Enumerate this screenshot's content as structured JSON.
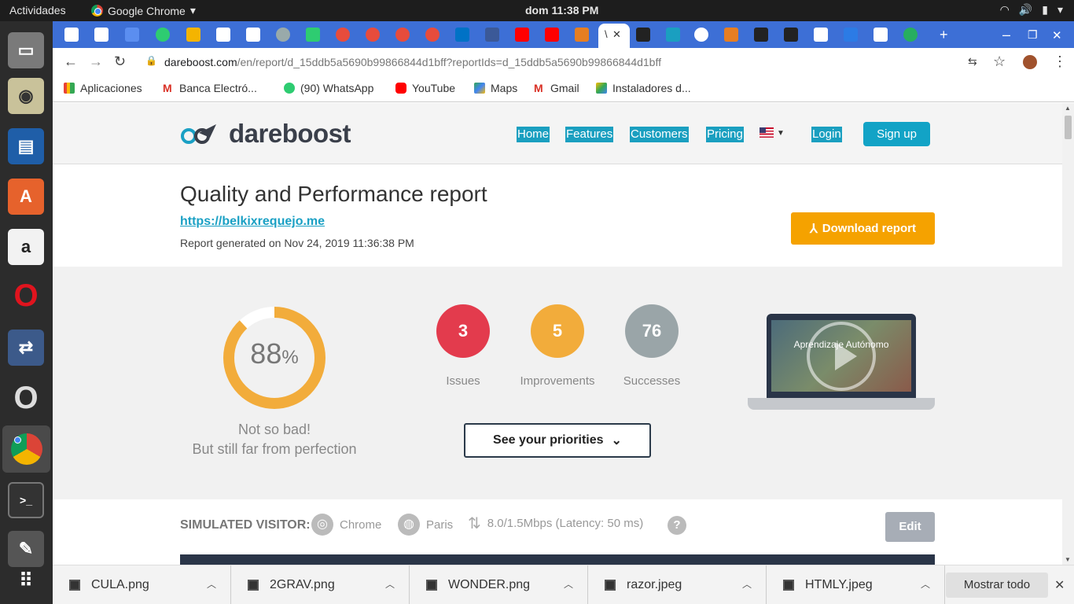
{
  "system": {
    "activities": "Actividades",
    "app_name": "Google Chrome",
    "clock": "dom 11:38 PM"
  },
  "browser": {
    "url_host": "dareboost.com",
    "url_path": "/en/report/d_15ddb5a5690b99866844d1bff?reportIds=d_15ddb5a5690b99866844d1bff",
    "active_tab_title": "\\",
    "bookmarks": [
      "Aplicaciones",
      "Banca Electró...",
      "(90) WhatsApp",
      "YouTube",
      "Maps",
      "Gmail",
      "Instaladores d..."
    ]
  },
  "site": {
    "logo_text": "dareboost",
    "nav": [
      "Home",
      "Features",
      "Customers",
      "Pricing"
    ],
    "login": "Login",
    "signup": "Sign up"
  },
  "report": {
    "title": "Quality and Performance report",
    "url": "https://belkixrequejo.me",
    "generated": "Report generated on Nov 24, 2019 11:36:38 PM",
    "download": "Download report"
  },
  "summary": {
    "score": "88",
    "score_unit": "%",
    "score_fraction": 0.88,
    "verdict_line1": "Not so bad!",
    "verdict_line2": "But still far from perfection",
    "issues_count": "3",
    "issues_label": "Issues",
    "improvements_count": "5",
    "improvements_label": "Improvements",
    "successes_count": "76",
    "successes_label": "Successes",
    "priorities_button": "See your priorities",
    "video_caption": "Aprendizaje Autónomo",
    "colors": {
      "issues": "#e33b4d",
      "improvements": "#f2ac3b",
      "successes": "#9aa5a8",
      "gauge": "#f2ac3b"
    }
  },
  "visitor": {
    "label": "SIMULATED VISITOR:",
    "browser": "Chrome",
    "location": "Paris",
    "connection": "8.0/1.5Mbps (Latency: 50 ms)",
    "edit": "Edit"
  },
  "downloads": {
    "files": [
      "CULA.png",
      "2GRAV.png",
      "WONDER.png",
      "razor.jpeg",
      "HTMLY.jpeg"
    ],
    "show_all": "Mostrar todo"
  }
}
